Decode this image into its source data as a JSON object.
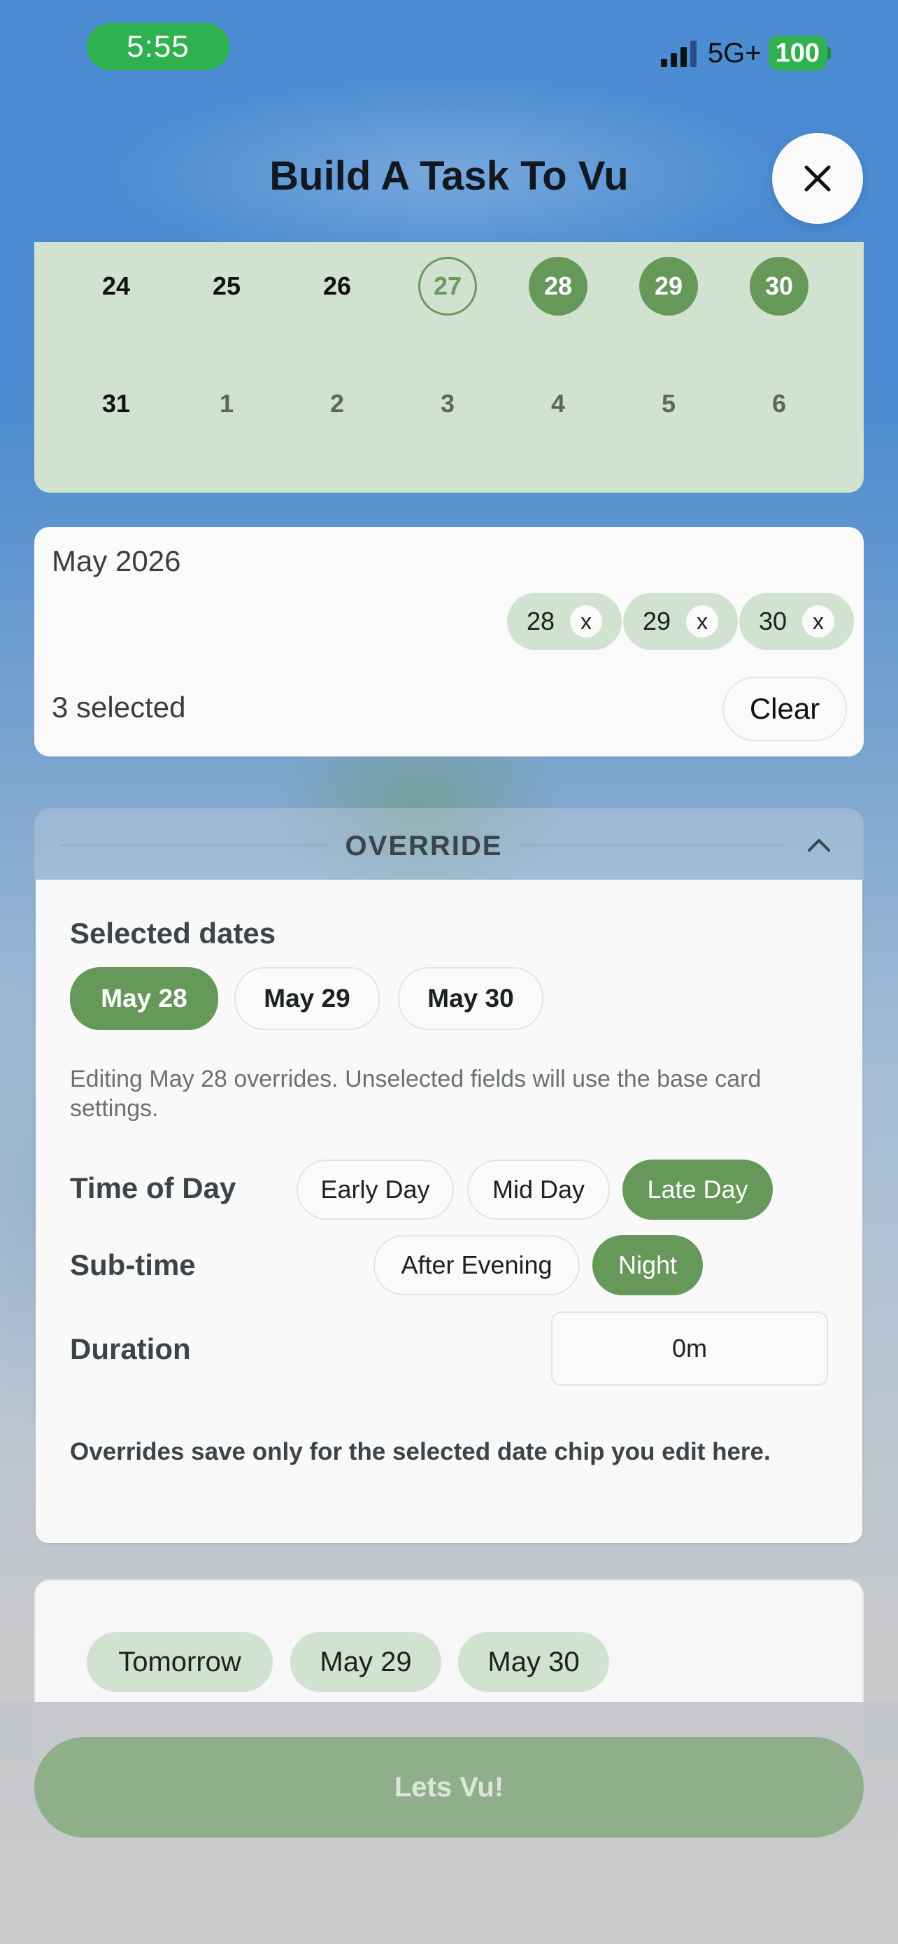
{
  "status_bar": {
    "time": "5:55",
    "network": "5G+",
    "battery": "100"
  },
  "header": {
    "title": "Build A Task To Vu"
  },
  "calendar": {
    "rows": [
      [
        {
          "d": "24",
          "state": "normal"
        },
        {
          "d": "25",
          "state": "normal"
        },
        {
          "d": "26",
          "state": "normal"
        },
        {
          "d": "27",
          "state": "today"
        },
        {
          "d": "28",
          "state": "selected"
        },
        {
          "d": "29",
          "state": "selected"
        },
        {
          "d": "30",
          "state": "selected"
        }
      ],
      [
        {
          "d": "31",
          "state": "normal"
        },
        {
          "d": "1",
          "state": "muted"
        },
        {
          "d": "2",
          "state": "muted"
        },
        {
          "d": "3",
          "state": "muted"
        },
        {
          "d": "4",
          "state": "muted"
        },
        {
          "d": "5",
          "state": "muted"
        },
        {
          "d": "6",
          "state": "muted"
        }
      ]
    ]
  },
  "selection": {
    "month": "May 2026",
    "chips": [
      {
        "label": "28",
        "remove": "x"
      },
      {
        "label": "29",
        "remove": "x"
      },
      {
        "label": "30",
        "remove": "x"
      }
    ],
    "count_text": "3 selected",
    "clear_label": "Clear"
  },
  "override": {
    "header": "OVERRIDE",
    "selected_dates_label": "Selected dates",
    "date_tabs": [
      "May 28",
      "May 29",
      "May 30"
    ],
    "active_date_index": 0,
    "note": "Editing May 28 overrides. Unselected fields will use the base card settings.",
    "time_of_day_label": "Time of Day",
    "time_of_day_options": [
      "Early Day",
      "Mid Day",
      "Late Day"
    ],
    "time_of_day_selected": "Late Day",
    "subtime_label": "Sub-time",
    "subtime_options": [
      "After Evening",
      "Night"
    ],
    "subtime_selected": "Night",
    "duration_label": "Duration",
    "duration_value": "0m",
    "footnote": "Overrides save only for the selected date chip you edit here."
  },
  "quick_dates": [
    "Tomorrow",
    "May 29",
    "May 30"
  ],
  "cta": {
    "label": "Lets Vu!"
  },
  "colors": {
    "accent": "#66985a",
    "accent_light": "#d1e2d0",
    "cta_disabled": "#8eaf8a",
    "status_green": "#30b14f"
  },
  "icons": {
    "close": "close-icon",
    "chevron": "chevron-up-icon",
    "signal": "signal-icon",
    "battery": "battery-icon"
  }
}
